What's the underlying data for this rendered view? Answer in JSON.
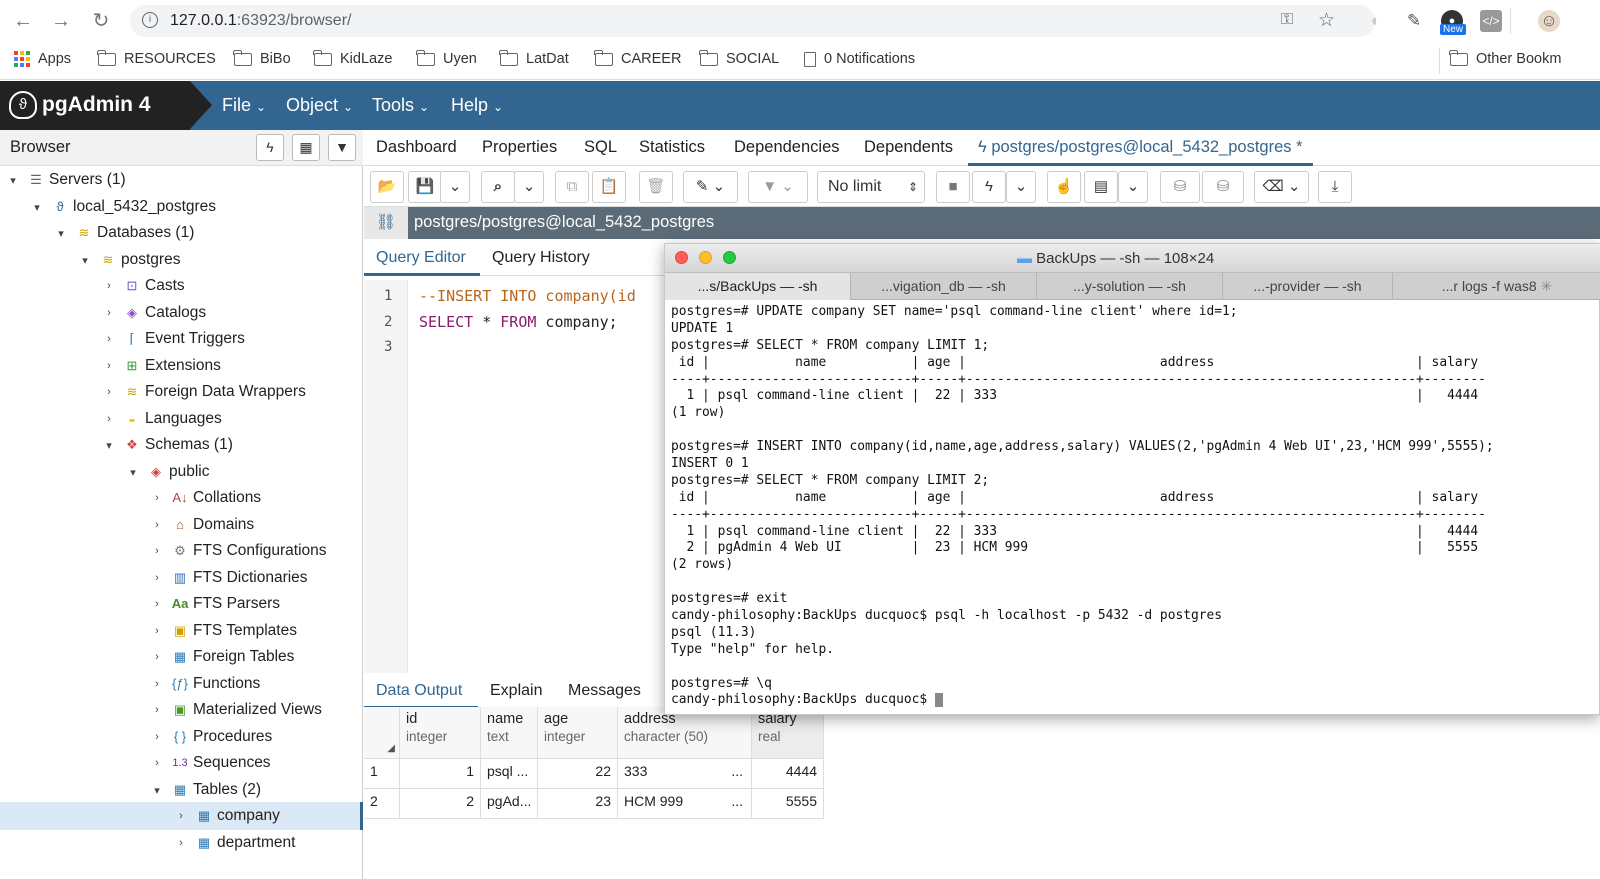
{
  "browser": {
    "url_host": "127.0.0.1",
    "url_path": ":63923/browser/",
    "ext_new_badge": "New"
  },
  "bookmarks": {
    "apps": "Apps",
    "items": [
      "RESOURCES",
      "BiBo",
      "KidLaze",
      "Uyen",
      "LatDat",
      "CAREER",
      "SOCIAL"
    ],
    "notifications": "0 Notifications",
    "other": "Other Bookm"
  },
  "pgadmin": {
    "title": "pgAdmin 4",
    "menus": [
      "File",
      "Object",
      "Tools",
      "Help"
    ]
  },
  "browser_panel": {
    "title": "Browser",
    "tree": [
      {
        "label": "Servers (1)",
        "icon": "servers-icon"
      },
      {
        "label": "local_5432_postgres",
        "icon": "elephant-icon"
      },
      {
        "label": "Databases (1)",
        "icon": "databases-icon"
      },
      {
        "label": "postgres",
        "icon": "database-icon"
      },
      {
        "label": "Casts",
        "icon": "casts-icon"
      },
      {
        "label": "Catalogs",
        "icon": "catalogs-icon"
      },
      {
        "label": "Event Triggers",
        "icon": "event-triggers-icon"
      },
      {
        "label": "Extensions",
        "icon": "extensions-icon"
      },
      {
        "label": "Foreign Data Wrappers",
        "icon": "fdw-icon"
      },
      {
        "label": "Languages",
        "icon": "languages-icon"
      },
      {
        "label": "Schemas (1)",
        "icon": "schemas-icon"
      },
      {
        "label": "public",
        "icon": "schema-icon"
      },
      {
        "label": "Collations",
        "icon": "collations-icon"
      },
      {
        "label": "Domains",
        "icon": "domains-icon"
      },
      {
        "label": "FTS Configurations",
        "icon": "fts-config-icon"
      },
      {
        "label": "FTS Dictionaries",
        "icon": "fts-dict-icon"
      },
      {
        "label": "FTS Parsers",
        "icon": "fts-parsers-icon"
      },
      {
        "label": "FTS Templates",
        "icon": "fts-templates-icon"
      },
      {
        "label": "Foreign Tables",
        "icon": "foreign-tables-icon"
      },
      {
        "label": "Functions",
        "icon": "functions-icon"
      },
      {
        "label": "Materialized Views",
        "icon": "mviews-icon"
      },
      {
        "label": "Procedures",
        "icon": "procedures-icon"
      },
      {
        "label": "Sequences",
        "icon": "sequences-icon"
      },
      {
        "label": "Tables (2)",
        "icon": "tables-icon"
      },
      {
        "label": "company",
        "icon": "table-icon"
      },
      {
        "label": "department",
        "icon": "table-icon"
      }
    ]
  },
  "main_tabs": [
    "Dashboard",
    "Properties",
    "SQL",
    "Statistics",
    "Dependencies",
    "Dependents"
  ],
  "active_tab": "postgres/postgres@local_5432_postgres *",
  "toolbar": {
    "limit": "No limit"
  },
  "connection": "postgres/postgres@local_5432_postgres",
  "editor_tabs": [
    "Query Editor",
    "Query History"
  ],
  "editor": {
    "lines": [
      "1",
      "2",
      "3"
    ],
    "line1": "--INSERT INTO company(id",
    "line2_kw1": "SELECT",
    "line2_mid": " * ",
    "line2_kw2": "FROM",
    "line2_rest": " company;"
  },
  "output_tabs": [
    "Data Output",
    "Explain",
    "Messages"
  ],
  "grid": {
    "columns": [
      {
        "name": "id",
        "type": "integer"
      },
      {
        "name": "name",
        "type": "text"
      },
      {
        "name": "age",
        "type": "integer"
      },
      {
        "name": "address",
        "type": "character (50)"
      },
      {
        "name": "salary",
        "type": "real"
      }
    ],
    "rows": [
      {
        "n": "1",
        "id": "1",
        "name": "psql ...",
        "age": "22",
        "address": "333",
        "more": "...",
        "salary": "4444"
      },
      {
        "n": "2",
        "id": "2",
        "name": "pgAd...",
        "age": "23",
        "address": "HCM 999",
        "more": "...",
        "salary": "5555"
      }
    ]
  },
  "terminal": {
    "title": "BackUps — -sh — 108×24",
    "tabs": [
      "...s/BackUps — -sh",
      "...vigation_db — -sh",
      "...y-solution — -sh",
      "...-provider — -sh",
      "...r logs -f was8"
    ],
    "lines": [
      "postgres=# UPDATE company SET name='psql command-line client' where id=1;",
      "UPDATE 1",
      "postgres=# SELECT * FROM company LIMIT 1;",
      " id |           name           | age |                         address                          | salary",
      "----+--------------------------+-----+----------------------------------------------------------+--------",
      "  1 | psql command-line client |  22 | 333                                                      |   4444",
      "(1 row)",
      "",
      "postgres=# INSERT INTO company(id,name,age,address,salary) VALUES(2,'pgAdmin 4 Web UI',23,'HCM 999',5555);",
      "INSERT 0 1",
      "postgres=# SELECT * FROM company LIMIT 2;",
      " id |           name           | age |                         address                          | salary",
      "----+--------------------------+-----+----------------------------------------------------------+--------",
      "  1 | psql command-line client |  22 | 333                                                      |   4444",
      "  2 | pgAdmin 4 Web UI         |  23 | HCM 999                                                  |   5555",
      "(2 rows)",
      "",
      "postgres=# exit",
      "candy-philosophy:BackUps ducquoc$ psql -h localhost -p 5432 -d postgres",
      "psql (11.3)",
      "Type \"help\" for help.",
      "",
      "postgres=# \\q",
      "candy-philosophy:BackUps ducquoc$ "
    ]
  }
}
